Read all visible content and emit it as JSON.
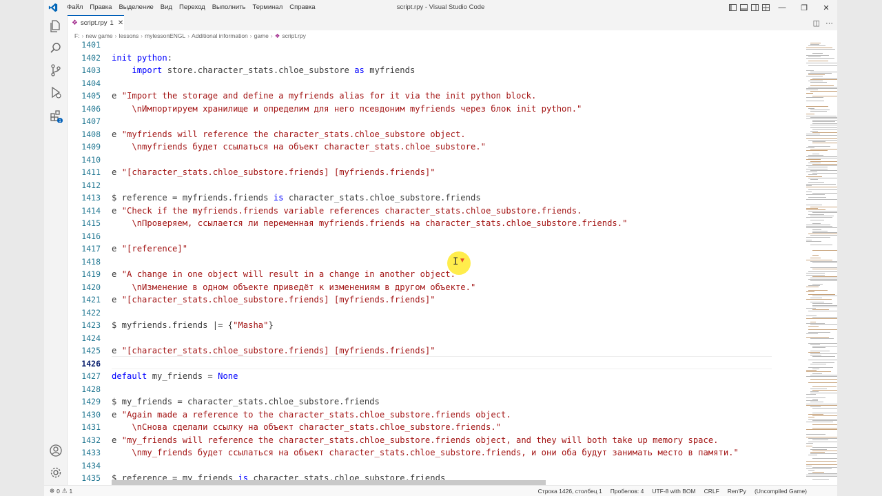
{
  "window": {
    "title": "script.rpy - Visual Studio Code",
    "menu": [
      "Файл",
      "Правка",
      "Выделение",
      "Вид",
      "Переход",
      "Выполнить",
      "Терминал",
      "Справка"
    ]
  },
  "tab": {
    "label": "script.rpy",
    "badge": "1"
  },
  "breadcrumbs": [
    "F:",
    "new game",
    "lessons",
    "mylessonENGL",
    "Additional information",
    "game",
    "script.rpy"
  ],
  "editor": {
    "active_line": "1426",
    "lines": [
      {
        "n": "1401",
        "text": ""
      },
      {
        "n": "1402",
        "text": "    init python:"
      },
      {
        "n": "1403",
        "text": "        import store.character_stats.chloe_substore as myfriends"
      },
      {
        "n": "1404",
        "text": ""
      },
      {
        "n": "1405",
        "text": "    e \"Import the storage and define a myfriends alias for it via the init python block."
      },
      {
        "n": "1406",
        "text": "        \\nИмпортируем хранилище и определим для него псевдоним myfriends через блок init python.\""
      },
      {
        "n": "1407",
        "text": ""
      },
      {
        "n": "1408",
        "text": "    e \"myfriends will reference the character_stats.chloe_substore object."
      },
      {
        "n": "1409",
        "text": "        \\nmyfriends будет ссылаться на объект character_stats.chloe_substore.\""
      },
      {
        "n": "1410",
        "text": ""
      },
      {
        "n": "1411",
        "text": "    e \"[character_stats.chloe_substore.friends] [myfriends.friends]\""
      },
      {
        "n": "1412",
        "text": ""
      },
      {
        "n": "1413",
        "text": "    $ reference = myfriends.friends is character_stats.chloe_substore.friends"
      },
      {
        "n": "1414",
        "text": "    e \"Check if the myfriends.friends variable references character_stats.chloe_substore.friends."
      },
      {
        "n": "1415",
        "text": "        \\nПроверяем, ссылается ли переменная myfriends.friends на character_stats.chloe_substore.friends.\""
      },
      {
        "n": "1416",
        "text": ""
      },
      {
        "n": "1417",
        "text": "    e \"[reference]\""
      },
      {
        "n": "1418",
        "text": ""
      },
      {
        "n": "1419",
        "text": "    e \"A change in one object will result in a change in another object."
      },
      {
        "n": "1420",
        "text": "        \\nИзменение в одном объекте приведёт к изменениям в другом объекте.\""
      },
      {
        "n": "1421",
        "text": "    e \"[character_stats.chloe_substore.friends] [myfriends.friends]\""
      },
      {
        "n": "1422",
        "text": ""
      },
      {
        "n": "1423",
        "text": "    $ myfriends.friends |= {\"Masha\"}"
      },
      {
        "n": "1424",
        "text": ""
      },
      {
        "n": "1425",
        "text": "    e \"[character_stats.chloe_substore.friends] [myfriends.friends]\""
      },
      {
        "n": "1426",
        "text": ""
      },
      {
        "n": "1427",
        "text": "    default my_friends = None"
      },
      {
        "n": "1428",
        "text": ""
      },
      {
        "n": "1429",
        "text": "    $ my_friends = character_stats.chloe_substore.friends"
      },
      {
        "n": "1430",
        "text": "    e \"Again made a reference to the character_stats.chloe_substore.friends object."
      },
      {
        "n": "1431",
        "text": "        \\nСнова сделали ссылку на объект character_stats.chloe_substore.friends.\""
      },
      {
        "n": "1432",
        "text": "    e \"my_friends will reference the character_stats.chloe_substore.friends object, and they will both take up memory space."
      },
      {
        "n": "1433",
        "text": "        \\nmy_friends будет ссылаться на объект character_stats.chloe_substore.friends, и они оба будут занимать место в памяти.\""
      },
      {
        "n": "1434",
        "text": ""
      },
      {
        "n": "1435",
        "text": "    $ reference = my_friends is character_stats.chloe_substore.friends"
      }
    ]
  },
  "statusbar": {
    "problems": "0",
    "warnings": "1",
    "position": "Строка 1426, столбец 1",
    "spaces": "Пробелов: 4",
    "encoding": "UTF-8 with BOM",
    "eol": "CRLF",
    "language": "Ren'Py",
    "extra": "(Uncompiled Game)"
  },
  "colors": {
    "accent": "#005fb8",
    "keyword": "#0000ff",
    "string": "#a31515",
    "line_number": "#237893"
  },
  "icons": [
    "vscode-logo-icon",
    "explorer-icon",
    "search-icon",
    "source-control-icon",
    "run-debug-icon",
    "extensions-icon",
    "account-icon",
    "settings-gear-icon"
  ]
}
